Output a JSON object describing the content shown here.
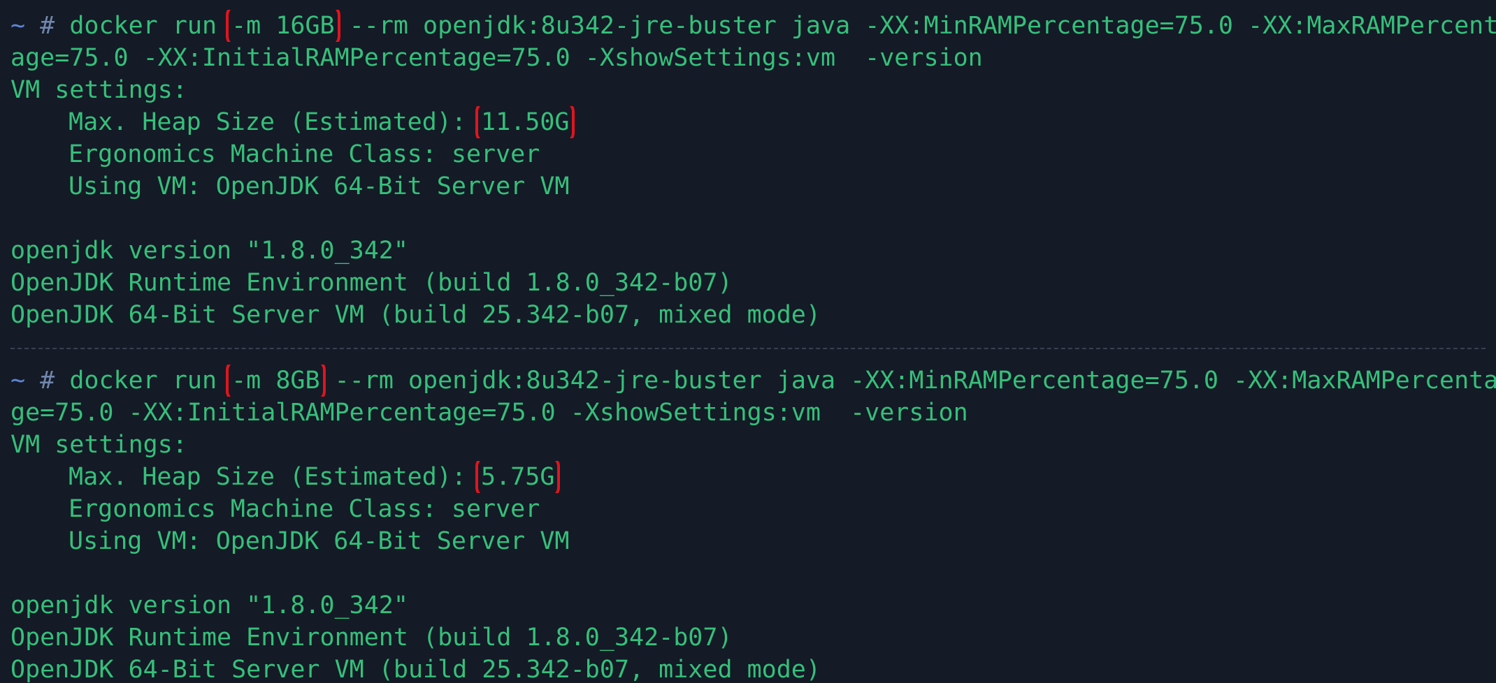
{
  "terminal": {
    "colors": {
      "background": "#141a26",
      "text": "#35c07a",
      "prompt_tilde": "#5e86d6",
      "prompt_hash": "#6f86ad",
      "highlight_box": "#e0141e",
      "separator": "#3a4050"
    },
    "blocks": [
      {
        "prompt_tilde": "~",
        "prompt_hash": "#",
        "cmd_prefix": "docker run ",
        "mem_flag": "-m 16GB",
        "cmd_rest": " --rm openjdk:8u342-jre-buster java -XX:MinRAMPercentage=75.0 -XX:MaxRAMPercent",
        "cmd_wrap": "age=75.0 -XX:InitialRAMPercentage=75.0 -XshowSettings:vm  -version",
        "vm_settings": "VM settings:",
        "heap_label": "Max. Heap Size (Estimated):",
        "heap_value": "11.50G",
        "ergonomics": "Ergonomics Machine Class: server",
        "using_vm": "Using VM: OpenJDK 64-Bit Server VM",
        "version_line": "openjdk version \"1.8.0_342\"",
        "runtime_line": "OpenJDK Runtime Environment (build 1.8.0_342-b07)",
        "server_vm_line": "OpenJDK 64-Bit Server VM (build 25.342-b07, mixed mode)"
      },
      {
        "prompt_tilde": "~",
        "prompt_hash": "#",
        "cmd_prefix": "docker run ",
        "mem_flag": "-m 8GB",
        "cmd_rest": " --rm openjdk:8u342-jre-buster java -XX:MinRAMPercentage=75.0 -XX:MaxRAMPercenta",
        "cmd_wrap": "ge=75.0 -XX:InitialRAMPercentage=75.0 -XshowSettings:vm  -version",
        "vm_settings": "VM settings:",
        "heap_label": "Max. Heap Size (Estimated):",
        "heap_value": "5.75G",
        "ergonomics": "Ergonomics Machine Class: server",
        "using_vm": "Using VM: OpenJDK 64-Bit Server VM",
        "version_line": "openjdk version \"1.8.0_342\"",
        "runtime_line": "OpenJDK Runtime Environment (build 1.8.0_342-b07)",
        "server_vm_line": "OpenJDK 64-Bit Server VM (build 25.342-b07, mixed mode)"
      }
    ]
  }
}
